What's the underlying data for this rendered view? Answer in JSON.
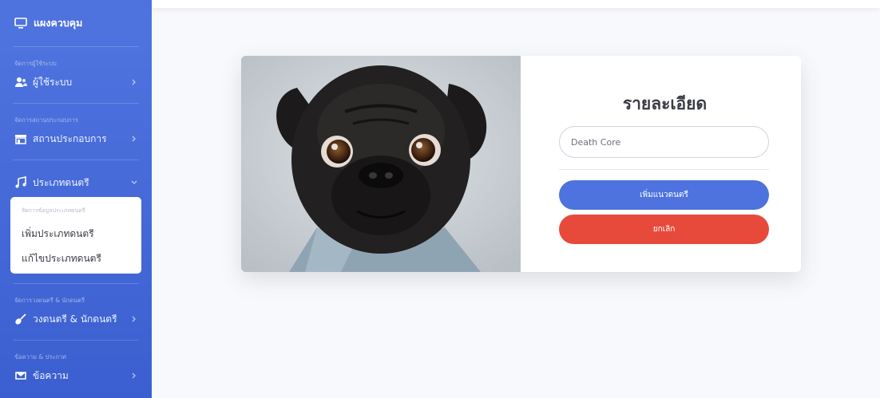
{
  "sidebar": {
    "brand": "แผงควบคุม",
    "sections": [
      {
        "heading": "จัดการผู้ใช้ระบบ",
        "item": "ผู้ใช้ระบบ",
        "icon": "users-icon"
      },
      {
        "heading": "จัดการสถานประกอบการ",
        "item": "สถานประกอบการ",
        "icon": "store-icon"
      },
      {
        "item": "ประเภทดนตรี",
        "icon": "music-icon",
        "expanded": true,
        "submenu": {
          "heading": "จัดการข้อมูลประเภทดนตรี",
          "items": [
            "เพิ่มประเภทดนตรี",
            "แก้ไขประเภทดนตรี"
          ]
        }
      },
      {
        "heading": "จัดการวงดนตรี & นักดนตรี",
        "item": "วงดนตรี & นักดนตรี",
        "icon": "guitar-icon"
      },
      {
        "heading": "ข้อความ & ประกาศ",
        "item": "ข้อความ",
        "icon": "message-icon"
      }
    ]
  },
  "card": {
    "title": "รายละเอียด",
    "field_value": "Death Core",
    "submit_label": "เพิ่มแนวดนตรี",
    "cancel_label": "ยกเลิก"
  },
  "colors": {
    "sidebar": "#4e73df",
    "primary": "#4e73df",
    "danger": "#e74a3b",
    "background": "#f8f9fc"
  }
}
